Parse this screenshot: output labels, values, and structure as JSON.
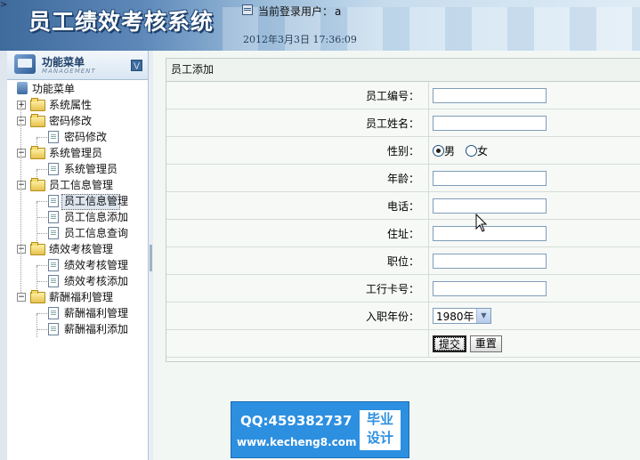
{
  "header": {
    "app_title": "员工绩效考核系统",
    "current_user_label": "当前登录用户：",
    "current_user": "a",
    "datetime": "2012年3月3日  17:36:09"
  },
  "sidebar": {
    "title": "功能菜单",
    "subtitle": "MANAGEMENT",
    "root": "功能菜单",
    "groups": [
      {
        "label": "系统属性",
        "expanded": false,
        "items": []
      },
      {
        "label": "密码修改",
        "expanded": true,
        "items": [
          {
            "label": "密码修改"
          }
        ]
      },
      {
        "label": "系统管理员",
        "expanded": true,
        "items": [
          {
            "label": "系统管理员"
          }
        ]
      },
      {
        "label": "员工信息管理",
        "expanded": true,
        "items": [
          {
            "label": "员工信息管理",
            "selected": true
          },
          {
            "label": "员工信息添加"
          },
          {
            "label": "员工信息查询"
          }
        ]
      },
      {
        "label": "绩效考核管理",
        "expanded": true,
        "items": [
          {
            "label": "绩效考核管理"
          },
          {
            "label": "绩效考核添加"
          }
        ]
      },
      {
        "label": "薪酬福利管理",
        "expanded": true,
        "items": [
          {
            "label": "薪酬福利管理"
          },
          {
            "label": "薪酬福利添加"
          }
        ]
      }
    ]
  },
  "form": {
    "title": "员工添加",
    "fields": {
      "emp_no_label": "员工编号：",
      "emp_name_label": "员工姓名：",
      "gender_label": "性别：",
      "gender_male": "男",
      "gender_female": "女",
      "gender_selected": "男",
      "age_label": "年龄：",
      "phone_label": "电话：",
      "address_label": "住址：",
      "position_label": "职位：",
      "bank_card_label": "工行卡号：",
      "join_year_label": "入职年份：",
      "join_year_value": "1980年"
    },
    "submit_label": "提交",
    "reset_label": "重置"
  },
  "watermark": {
    "qq": "QQ:459382737",
    "url": "www.kecheng8.com",
    "badge_line1": "毕业",
    "badge_line2": "设计"
  }
}
